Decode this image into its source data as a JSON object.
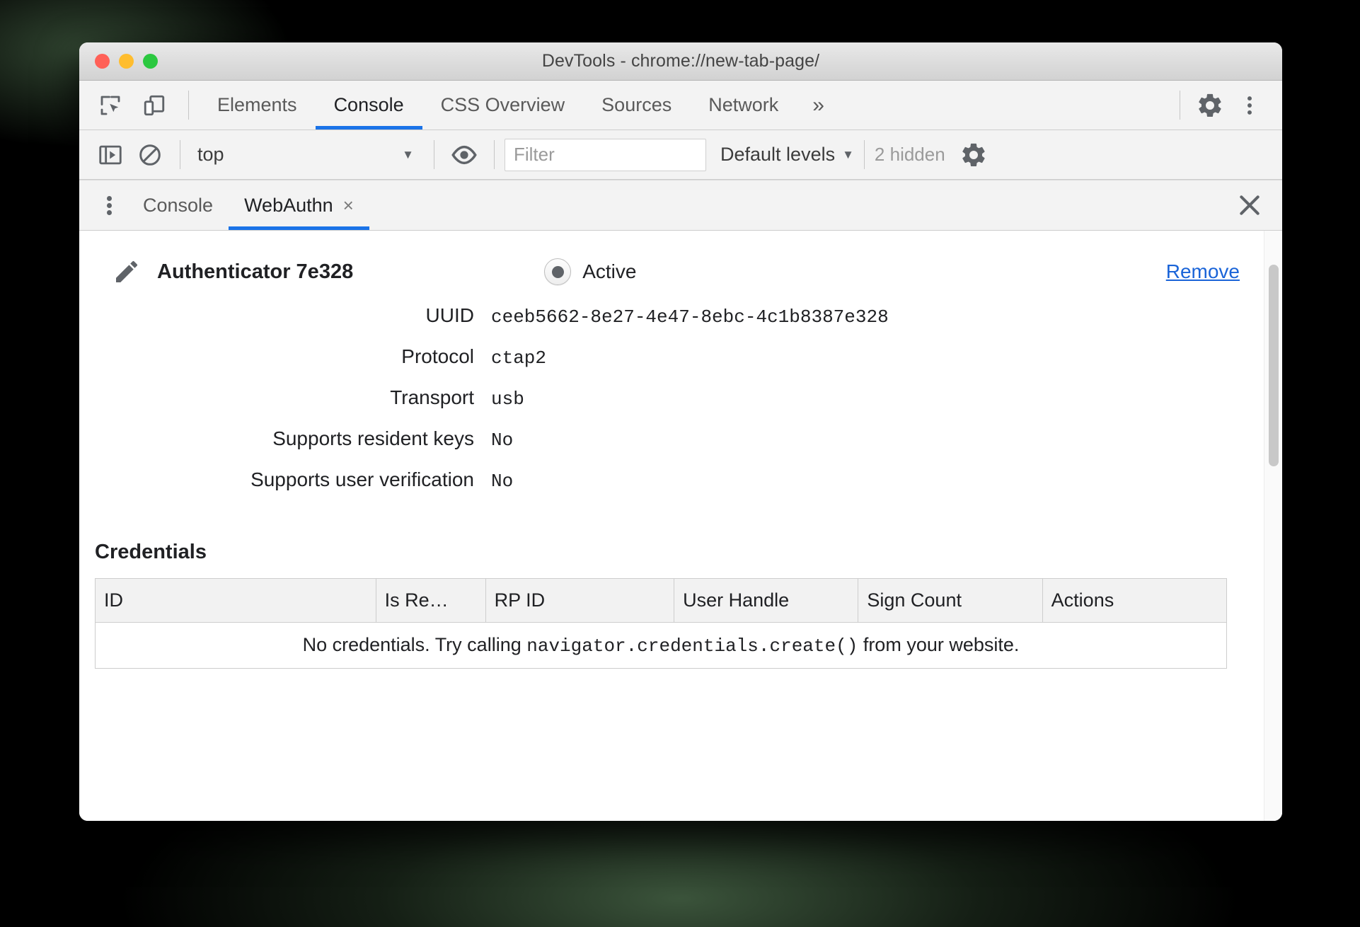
{
  "window": {
    "title": "DevTools - chrome://new-tab-page/",
    "traffic_lights": [
      "close-red",
      "minimize-yellow",
      "zoom-green"
    ]
  },
  "main_toolbar": {
    "icons": [
      {
        "name": "inspect-element-icon",
        "label": "Inspect element"
      },
      {
        "name": "device-toolbar-icon",
        "label": "Toggle device toolbar"
      }
    ],
    "tabs": [
      {
        "label": "Elements",
        "active": false
      },
      {
        "label": "Console",
        "active": true
      },
      {
        "label": "CSS Overview",
        "active": false
      },
      {
        "label": "Sources",
        "active": false
      },
      {
        "label": "Network",
        "active": false
      }
    ],
    "more_tabs_label": "»",
    "settings_icon": "gear-icon",
    "menu_icon": "three-dots-vertical-icon"
  },
  "console_toolbar": {
    "sidebar_toggle_icon": "console-sidebar-icon",
    "clear_console_icon": "clear-console-icon",
    "context": {
      "value": "top",
      "caret": "▼"
    },
    "live_expression_icon": "eye-icon",
    "filter": {
      "value": "",
      "placeholder": "Filter"
    },
    "levels": {
      "label": "Default levels",
      "caret": "▼"
    },
    "hidden_messages": "2 hidden",
    "settings_icon": "gear-icon"
  },
  "drawer": {
    "menu_icon": "three-dots-vertical-icon",
    "tabs": [
      {
        "label": "Console",
        "active": false,
        "closable": false
      },
      {
        "label": "WebAuthn",
        "active": true,
        "closable": true,
        "close_glyph": "×"
      }
    ],
    "close_glyph": "✕"
  },
  "webauthn": {
    "edit_icon": "pencil-icon",
    "authenticator_name": "Authenticator 7e328",
    "active_state": {
      "label": "Active",
      "selected": true
    },
    "remove_label": "Remove",
    "details": [
      {
        "label": "UUID",
        "value": "ceeb5662-8e27-4e47-8ebc-4c1b8387e328"
      },
      {
        "label": "Protocol",
        "value": "ctap2"
      },
      {
        "label": "Transport",
        "value": "usb"
      },
      {
        "label": "Supports resident keys",
        "value": "No"
      },
      {
        "label": "Supports user verification",
        "value": "No"
      }
    ],
    "credentials": {
      "heading": "Credentials",
      "columns": [
        "ID",
        "Is Re…",
        "RP ID",
        "User Handle",
        "Sign Count",
        "Actions"
      ],
      "rows": [],
      "empty_message": {
        "before": "No credentials. Try calling ",
        "code": "navigator.credentials.create()",
        "after": " from your website."
      }
    }
  },
  "colors": {
    "accent_blue": "#1a73e8",
    "link_blue": "#1a64d8",
    "text_primary": "#202124",
    "text_secondary": "#5a5a5a",
    "toolbar_bg": "#f3f3f3",
    "panel_bg": "#ffffff",
    "border": "#cdcdcd"
  }
}
